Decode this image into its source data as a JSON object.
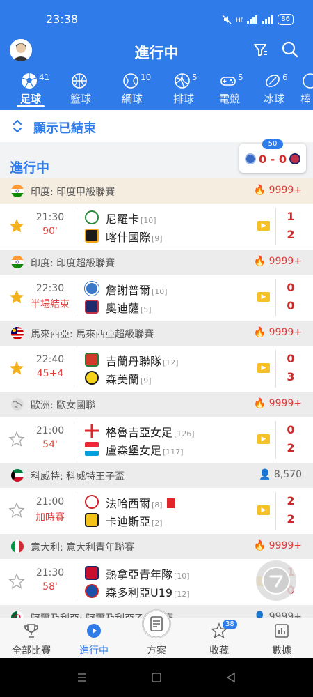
{
  "status": {
    "time": "23:38",
    "battery": "86"
  },
  "header": {
    "title": "進行中"
  },
  "tabs": [
    {
      "label": "足球",
      "count": "41",
      "icon": "soccer-ball-icon"
    },
    {
      "label": "籃球",
      "count": "",
      "icon": "basketball-icon"
    },
    {
      "label": "網球",
      "count": "10",
      "icon": "tennis-icon"
    },
    {
      "label": "排球",
      "count": "5",
      "icon": "volleyball-icon"
    },
    {
      "label": "電競",
      "count": "5",
      "icon": "gamepad-icon"
    },
    {
      "label": "冰球",
      "count": "6",
      "icon": "hockey-icon"
    },
    {
      "label": "棒",
      "count": "",
      "icon": "baseball-icon"
    }
  ],
  "show_finished": "顯示已結束",
  "section": {
    "label": "進行中",
    "live_count": "50",
    "live_score": "0 - 0"
  },
  "leagues": [
    {
      "name": "印度: 印度甲級聯賽",
      "heat": "9999+",
      "match": {
        "time": "21:30",
        "status": "90'",
        "home": "尼羅卡",
        "home_rank": "[10]",
        "away": "喀什國際",
        "away_rank": "[9]",
        "home_score": "1",
        "away_score": "2"
      }
    },
    {
      "name": "印度: 印度超級聯賽",
      "heat": "9999+",
      "match": {
        "time": "22:30",
        "status": "半場結束",
        "home": "詹謝普爾",
        "home_rank": "[10]",
        "away": "奧迪薩",
        "away_rank": "[5]",
        "home_score": "0",
        "away_score": "0"
      }
    },
    {
      "name": "馬來西亞: 馬來西亞超級聯賽",
      "heat": "9999+",
      "match": {
        "time": "22:40",
        "status": "45+4",
        "home": "吉蘭丹聯隊",
        "home_rank": "[12]",
        "away": "森美蘭",
        "away_rank": "[9]",
        "home_score": "0",
        "away_score": "3"
      }
    },
    {
      "name": "歐洲: 歐女國聯",
      "heat": "9999+",
      "match": {
        "time": "21:00",
        "status": "54'",
        "home": "格魯吉亞女足",
        "home_rank": "[126]",
        "away": "盧森堡女足",
        "away_rank": "[117]",
        "home_score": "0",
        "away_score": "2"
      }
    },
    {
      "name": "科威特: 科威特王子盃",
      "heat": "8,570",
      "match": {
        "time": "21:00",
        "status": "加時賽",
        "home": "法哈西爾",
        "home_rank": "[8]",
        "away": "卡迪斯亞",
        "away_rank": "[2]",
        "home_score": "2",
        "away_score": "2"
      }
    },
    {
      "name": "意大利: 意大利青年聯賽",
      "heat": "9999+",
      "match": {
        "time": "21:30",
        "status": "58'",
        "home": "熱拿亞青年隊",
        "home_rank": "[10]",
        "away": "森多利亞U19",
        "away_rank": "[12]",
        "home_score": "1",
        "away_score": "0"
      }
    },
    {
      "name": "阿爾及利亞: 阿爾及利亞乙級聯賽",
      "heat": "9999+"
    }
  ],
  "bottom_nav": [
    {
      "label": "全部比賽"
    },
    {
      "label": "進行中"
    },
    {
      "label": "方案"
    },
    {
      "label": "收藏",
      "badge": "38"
    },
    {
      "label": "數據"
    }
  ],
  "colors": {
    "primary": "#2f7be9",
    "live_red": "#e03c3c"
  }
}
